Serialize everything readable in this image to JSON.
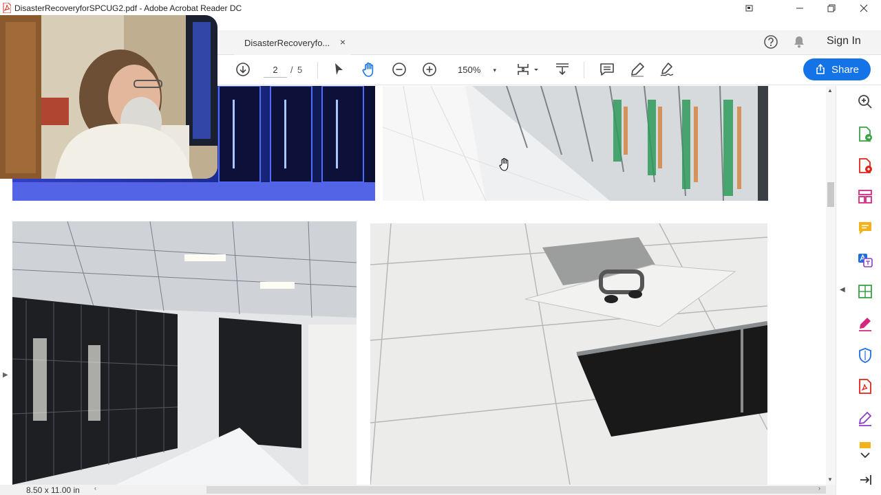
{
  "window": {
    "title": "DisasterRecoveryforSPCUG2.pdf - Adobe Acrobat Reader DC"
  },
  "tabs": [
    {
      "label": "DisasterRecoveryfo...",
      "close": "×"
    }
  ],
  "header": {
    "sign_in": "Sign In"
  },
  "toolbar": {
    "page_current": "2",
    "page_separator": "/",
    "page_total": "5",
    "zoom": "150%",
    "zoom_caret": "▾",
    "share_label": "Share"
  },
  "status": {
    "page_size": "8.50 x 11.00 in"
  },
  "colors": {
    "accent": "#1473e6",
    "acrobat_red": "#e0241a",
    "rail_pink": "#d4267e",
    "rail_green": "#3aa144",
    "rail_yellow": "#f2b21b",
    "rail_blue": "#1f6ee0",
    "rail_purple": "#8a3cc9"
  },
  "icons": [
    "acrobat-app-icon",
    "restore-window-icon",
    "minimize-icon",
    "maximize-icon",
    "close-icon",
    "help-icon",
    "notification-bell-icon",
    "next-page-icon",
    "select-tool-icon",
    "hand-tool-icon",
    "zoom-out-icon",
    "zoom-in-icon",
    "page-fit-icon",
    "scroll-mode-icon",
    "comment-icon",
    "highlight-pen-icon",
    "sign-icon",
    "share-icon",
    "search-zoom-icon",
    "export-pdf-icon",
    "create-pdf-icon",
    "organize-pages-icon",
    "comment-tool-icon",
    "translate-icon",
    "compress-icon",
    "fill-sign-icon",
    "protect-icon",
    "pdf-icon",
    "edit-pdf-icon",
    "more-tools-icon",
    "collapse-pane-icon"
  ]
}
